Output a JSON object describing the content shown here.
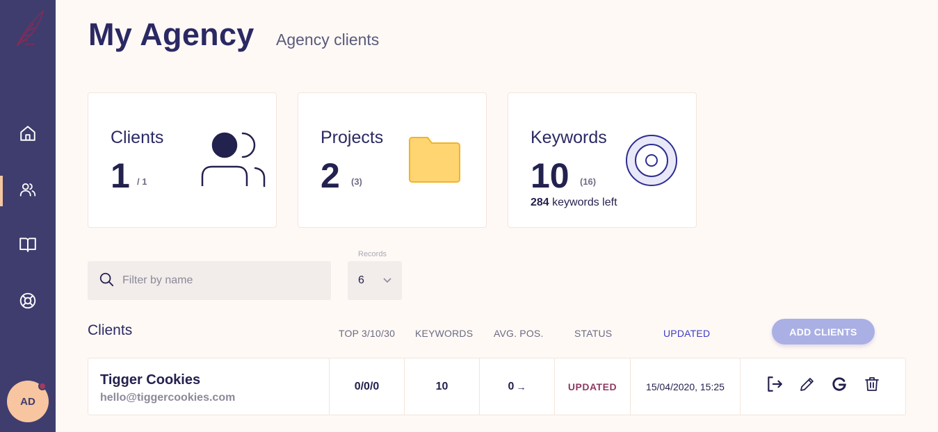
{
  "header": {
    "title": "My Agency",
    "subtitle": "Agency clients"
  },
  "user": {
    "initials": "AD"
  },
  "sidebar": {
    "items": [
      {
        "name": "home-icon"
      },
      {
        "name": "users-icon",
        "active": true
      },
      {
        "name": "book-icon"
      },
      {
        "name": "lifebuoy-icon"
      }
    ]
  },
  "cards": {
    "clients": {
      "label": "Clients",
      "value": "1",
      "sub": "/ 1",
      "icon": "users-icon"
    },
    "projects": {
      "label": "Projects",
      "value": "2",
      "sub": "(3)",
      "icon": "folder-icon"
    },
    "keywords": {
      "label": "Keywords",
      "value": "10",
      "sub": "(16)",
      "left_count": "284",
      "left_text": "keywords left",
      "icon": "target-icon"
    }
  },
  "filters": {
    "search_placeholder": "Filter by name",
    "records_label": "Records",
    "records_value": "6"
  },
  "table": {
    "title": "Clients",
    "columns": {
      "top": "TOP 3/10/30",
      "keywords": "KEYWORDS",
      "avg_pos": "AVG. POS.",
      "status": "STATUS",
      "updated": "UPDATED"
    },
    "add_button": "ADD CLIENTS",
    "rows": [
      {
        "name": "Tigger Cookies",
        "email": "hello@tiggercookies.com",
        "top": "0/0/0",
        "keywords": "10",
        "avg_pos": "0",
        "avg_trend": "→",
        "status": "UPDATED",
        "updated": "15/04/2020, 15:25"
      }
    ]
  },
  "colors": {
    "sidebar": "#3f3d6e",
    "background": "#fff9f6",
    "accent": "#aab0e4",
    "status": "#8e3a62",
    "folder": "#ffd572",
    "link": "#3d3bc4"
  }
}
